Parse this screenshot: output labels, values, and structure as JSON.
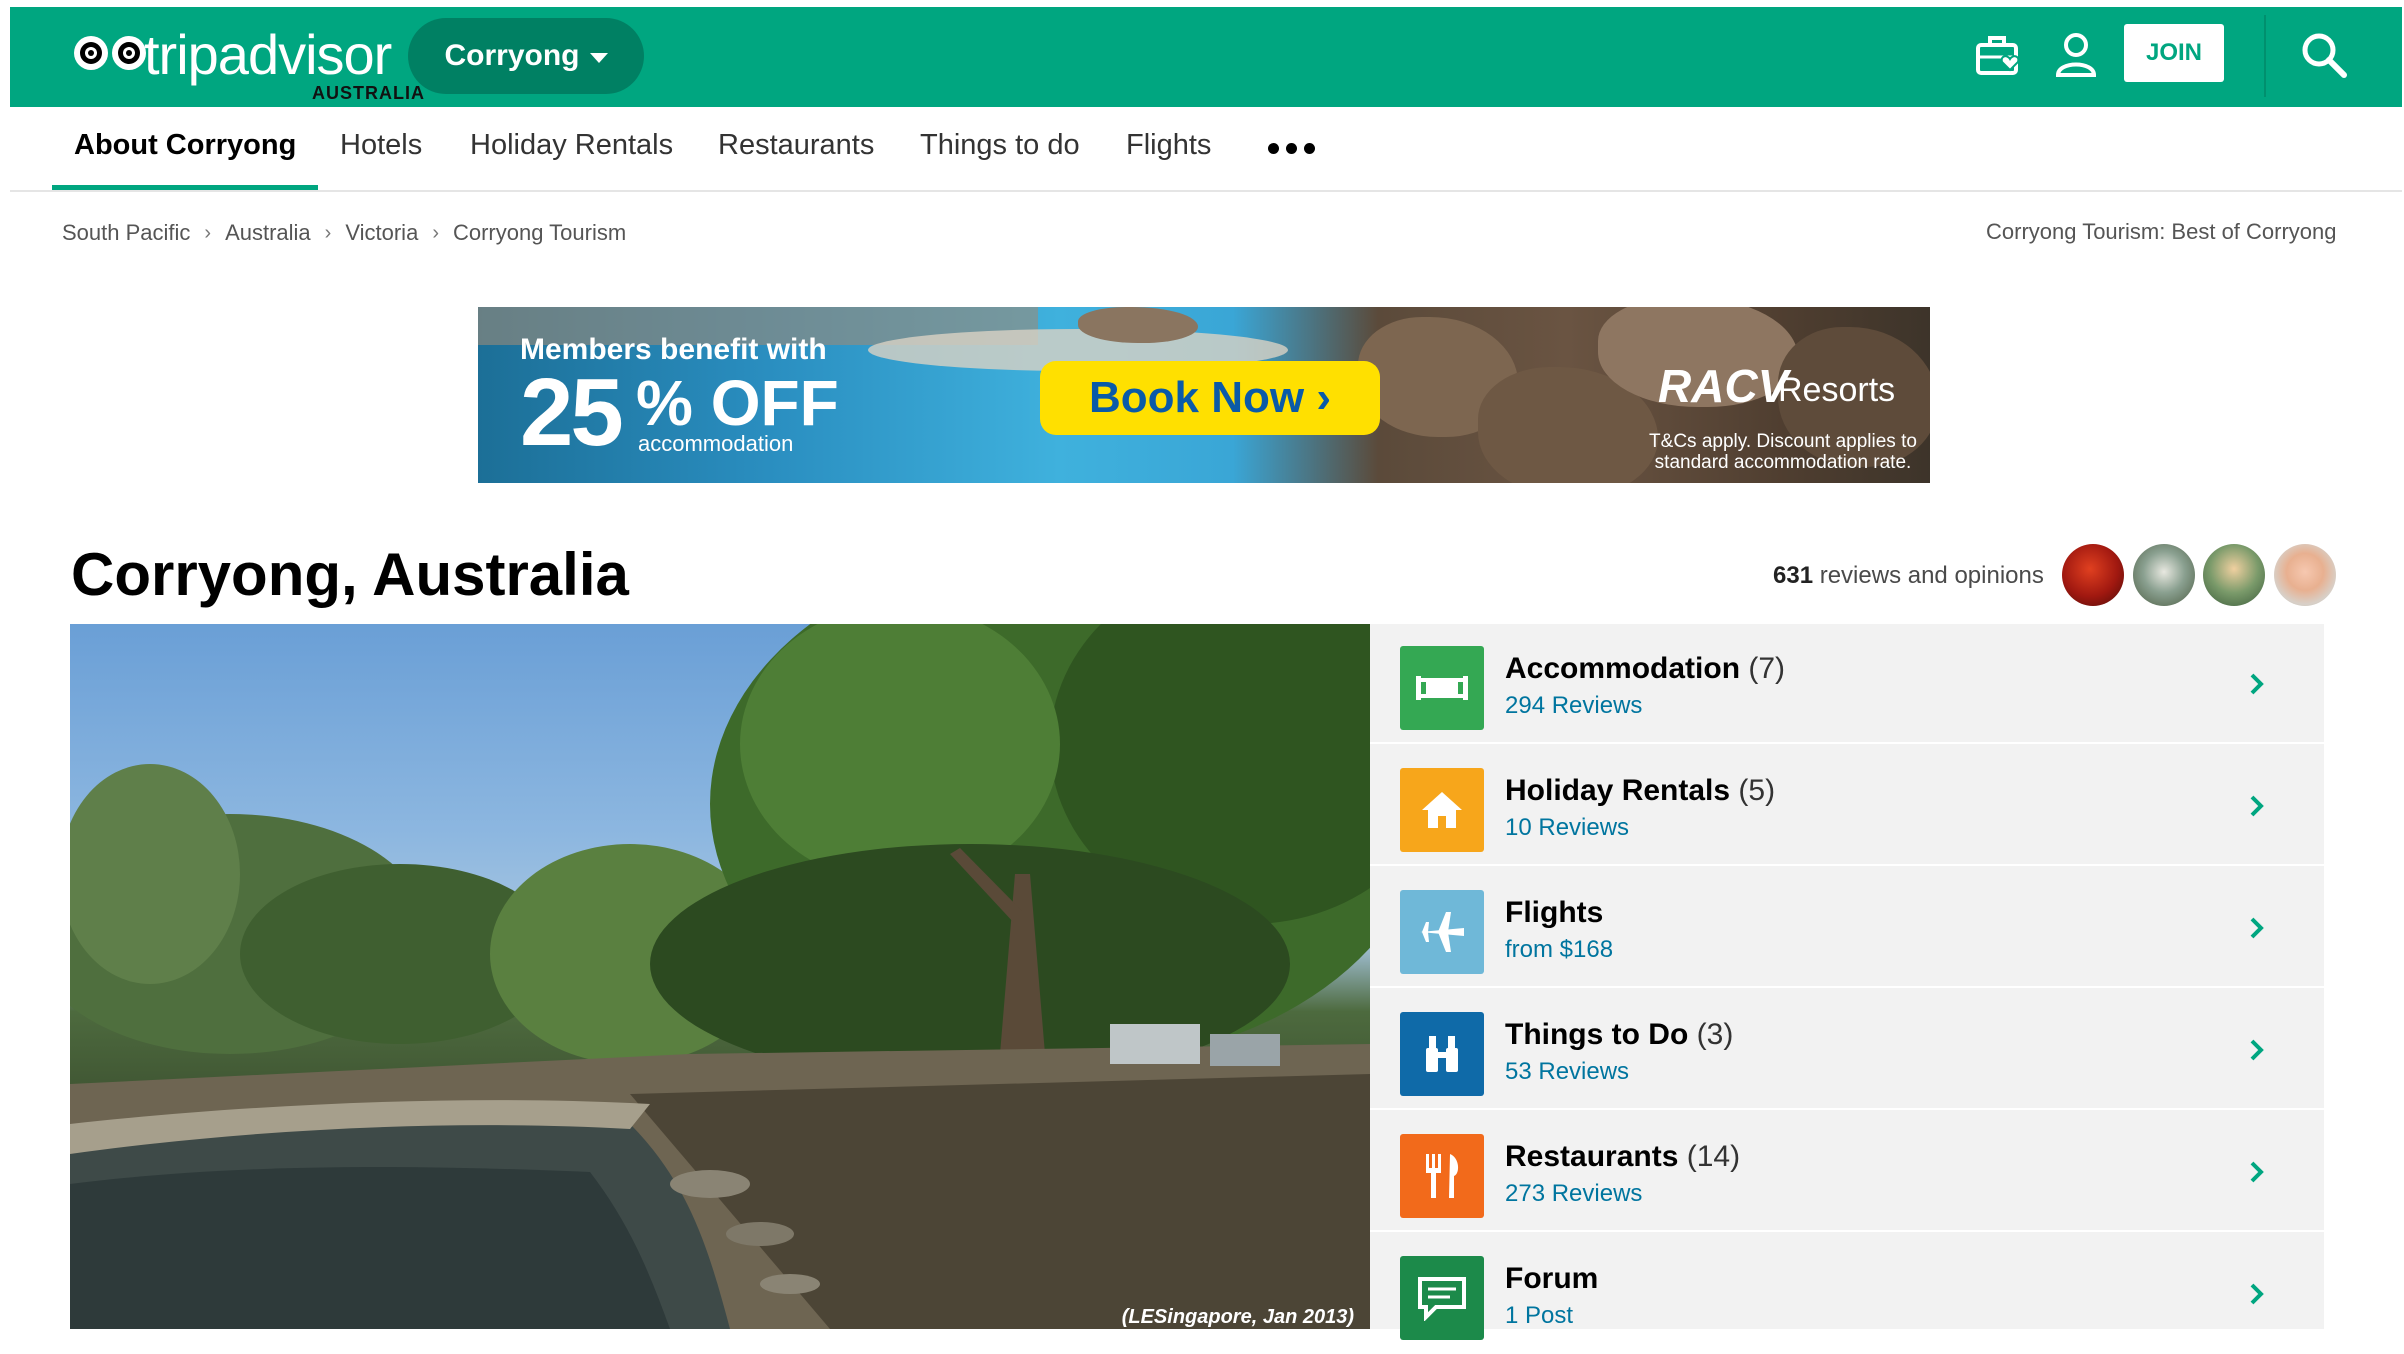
{
  "header": {
    "logo_text": "tripadvisor",
    "logo_sub": "AUSTRALIA",
    "geo_label": "Corryong",
    "join_label": "JOIN",
    "brand_color": "#00a680",
    "icons": [
      "trips-icon",
      "profile-icon",
      "search-icon"
    ]
  },
  "nav": {
    "items": [
      {
        "label": "About Corryong",
        "active": true
      },
      {
        "label": "Hotels"
      },
      {
        "label": "Holiday Rentals"
      },
      {
        "label": "Restaurants"
      },
      {
        "label": "Things to do"
      },
      {
        "label": "Flights"
      }
    ],
    "more_icon": "more-dots-icon"
  },
  "breadcrumb": {
    "items": [
      "South Pacific",
      "Australia",
      "Victoria",
      "Corryong Tourism"
    ],
    "separator": "›",
    "right_text": "Corryong Tourism: Best of Corryong"
  },
  "banner": {
    "line1": "Members benefit with",
    "discount_number": "25",
    "discount_suffix": "% OFF",
    "discount_note": "accommodation",
    "cta": "Book Now ›",
    "brand": "RACV",
    "brand_suffix": "Resorts",
    "disclaimer": "T&Cs apply. Discount applies to standard accommodation rate."
  },
  "title": {
    "heading": "Corryong, Australia",
    "review_count": "631",
    "review_label": " reviews and opinions"
  },
  "hero": {
    "credit": "(LESingapore, Jan 2013)"
  },
  "categories": [
    {
      "name": "Accommodation",
      "count": "(7)",
      "sub": "294 Reviews",
      "icon": "bed-icon",
      "color": "#34a853"
    },
    {
      "name": "Holiday Rentals",
      "count": "(5)",
      "sub": "10 Reviews",
      "icon": "house-icon",
      "color": "#f7a61b"
    },
    {
      "name": "Flights",
      "count": "",
      "sub": "from $168",
      "icon": "plane-icon",
      "color": "#6fb8d8"
    },
    {
      "name": "Things to Do",
      "count": "(3)",
      "sub": "53 Reviews",
      "icon": "binoculars-icon",
      "color": "#0f6aa8"
    },
    {
      "name": "Restaurants",
      "count": "(14)",
      "sub": "273 Reviews",
      "icon": "fork-knife-icon",
      "color": "#f26a1b"
    },
    {
      "name": "Forum",
      "count": "",
      "sub": "1 Post",
      "icon": "chat-icon",
      "color": "#1c8a4a"
    }
  ]
}
